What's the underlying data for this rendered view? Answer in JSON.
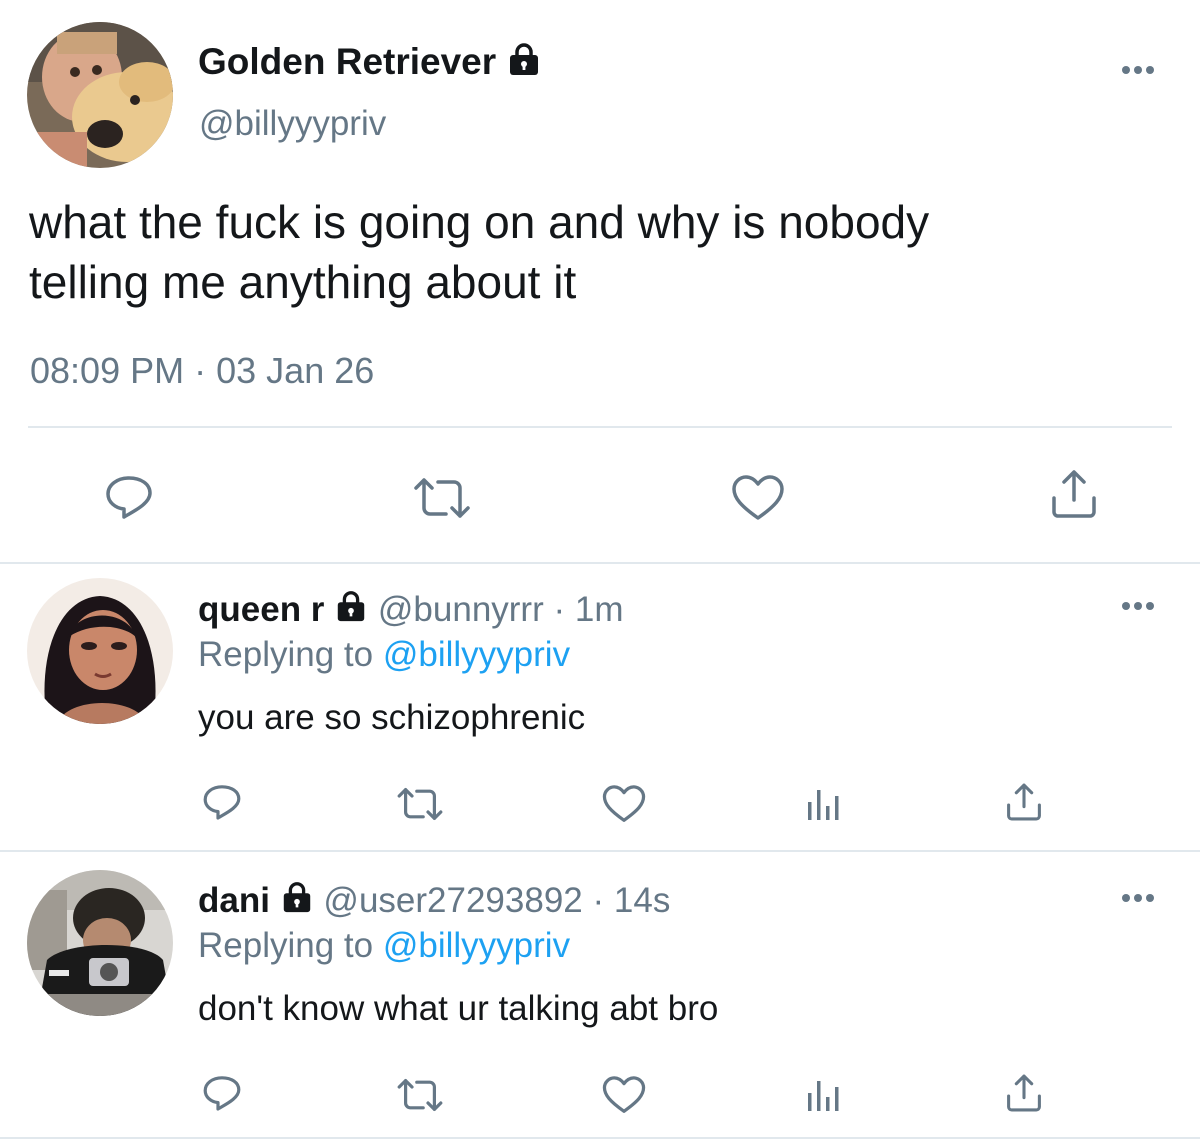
{
  "main_tweet": {
    "display_name": "Golden Retriever",
    "handle": "@billyyypriv",
    "text_line1": "what the fuck is going on and why is nobody",
    "text_line2": "telling me anything about it",
    "time": "08:09 PM",
    "separator": "·",
    "date": "03 Jan 26",
    "avatar_icon": "dog-selfie-avatar",
    "actions": [
      "reply-icon",
      "retweet-icon",
      "like-icon",
      "share-icon"
    ]
  },
  "replies": [
    {
      "display_name": "queen r",
      "handle": "@bunnyrrr",
      "separator": "·",
      "time_ago": "1m",
      "replying_prefix": "Replying to",
      "replying_to": "@billyyypriv",
      "text": "you are so schizophrenic",
      "avatar_icon": "anime-girl-avatar",
      "actions": [
        "reply-icon",
        "retweet-icon",
        "like-icon",
        "analytics-icon",
        "share-icon"
      ]
    },
    {
      "display_name": "dani",
      "handle": "@user27293892",
      "separator": "·",
      "time_ago": "14s",
      "replying_prefix": "Replying to",
      "replying_to": "@billyyypriv",
      "text": "don't know what ur talking abt bro",
      "avatar_icon": "mirror-selfie-avatar",
      "actions": [
        "reply-icon",
        "retweet-icon",
        "like-icon",
        "analytics-icon",
        "share-icon"
      ]
    }
  ],
  "colors": {
    "text": "#14171a",
    "secondary": "#657786",
    "link": "#1da1f2",
    "divider": "#e1e8ed"
  }
}
